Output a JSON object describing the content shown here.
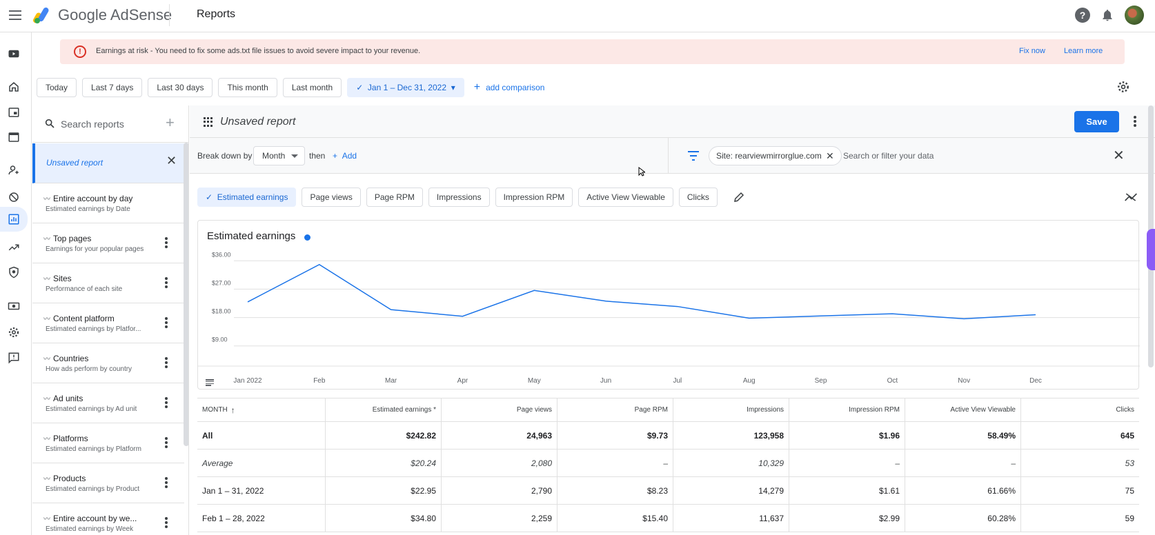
{
  "app": {
    "brand": "Google AdSense",
    "page_title": "Reports"
  },
  "alert": {
    "text": "Earnings at risk - You need to fix some ads.txt file issues to avoid severe impact to your revenue.",
    "fix_label": "Fix now",
    "learn_label": "Learn more",
    "color": "#fce8e6"
  },
  "date_ranges": [
    "Today",
    "Last 7 days",
    "Last 30 days",
    "This month",
    "Last month"
  ],
  "selected_range": "Jan 1 – Dec 31, 2022",
  "add_comparison": "add comparison",
  "search": {
    "placeholder": "Search reports"
  },
  "reports": [
    {
      "title": "Unsaved report",
      "sub": ""
    },
    {
      "title": "Entire account by day",
      "sub": "Estimated earnings by Date"
    },
    {
      "title": "Top pages",
      "sub": "Earnings for your popular pages"
    },
    {
      "title": "Sites",
      "sub": "Performance of each site"
    },
    {
      "title": "Content platform",
      "sub": "Estimated earnings by Platfor..."
    },
    {
      "title": "Countries",
      "sub": "How ads perform by country"
    },
    {
      "title": "Ad units",
      "sub": "Estimated earnings by Ad unit"
    },
    {
      "title": "Platforms",
      "sub": "Estimated earnings by Platform"
    },
    {
      "title": "Products",
      "sub": "Estimated earnings by Product"
    },
    {
      "title": "Entire account by we...",
      "sub": "Estimated earnings by Week"
    }
  ],
  "report": {
    "title": "Unsaved report",
    "save_label": "Save"
  },
  "breakdown": {
    "label": "Break down by",
    "value": "Month",
    "then": "then",
    "add": "Add"
  },
  "filter": {
    "chip": "Site: rearviewmirrorglue.com",
    "placeholder": "Search or filter your data"
  },
  "metrics": [
    "Estimated earnings",
    "Page views",
    "Page RPM",
    "Impressions",
    "Impression RPM",
    "Active View Viewable",
    "Clicks"
  ],
  "chart_data": {
    "type": "line",
    "title": "Estimated earnings",
    "categories": [
      "Jan 2022",
      "Feb",
      "Mar",
      "Apr",
      "May",
      "Jun",
      "Jul",
      "Aug",
      "Sep",
      "Oct",
      "Nov",
      "Dec"
    ],
    "series": [
      {
        "values": [
          22.95,
          34.8,
          20.5,
          18.4,
          26.6,
          23.2,
          21.5,
          17.8,
          18.5,
          19.2,
          17.6,
          18.9
        ]
      }
    ],
    "y_ticks": [
      "$36.00",
      "$27.00",
      "$18.00",
      "$9.00"
    ],
    "ylim": [
      5,
      40
    ],
    "grid": true,
    "color": "#1a73e8"
  },
  "table": {
    "headers": [
      "MONTH",
      "Estimated earnings *",
      "Page views",
      "Page RPM",
      "Impressions",
      "Impression RPM",
      "Active View Viewable",
      "Clicks"
    ],
    "total": [
      "All",
      "$242.82",
      "24,963",
      "$9.73",
      "123,958",
      "$1.96",
      "58.49%",
      "645"
    ],
    "average": [
      "Average",
      "$20.24",
      "2,080",
      "–",
      "10,329",
      "–",
      "–",
      "53"
    ],
    "rows": [
      [
        "Jan 1 – 31, 2022",
        "$22.95",
        "2,790",
        "$8.23",
        "14,279",
        "$1.61",
        "61.66%",
        "75"
      ],
      [
        "Feb 1 – 28, 2022",
        "$34.80",
        "2,259",
        "$15.40",
        "11,637",
        "$2.99",
        "60.28%",
        "59"
      ]
    ]
  }
}
